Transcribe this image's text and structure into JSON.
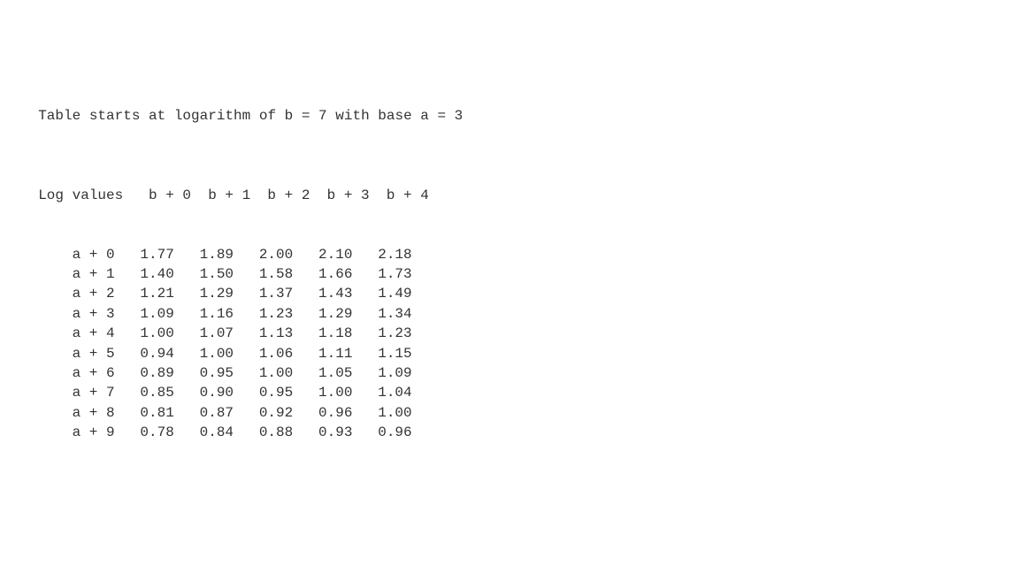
{
  "title": "Table starts at logarithm of b = 7 with base a = 3",
  "header_label": "Log values",
  "columns": [
    "b + 0",
    "b + 1",
    "b + 2",
    "b + 3",
    "b + 4"
  ],
  "rows": [
    {
      "label": "a + 0",
      "values": [
        "1.77",
        "1.89",
        "2.00",
        "2.10",
        "2.18"
      ]
    },
    {
      "label": "a + 1",
      "values": [
        "1.40",
        "1.50",
        "1.58",
        "1.66",
        "1.73"
      ]
    },
    {
      "label": "a + 2",
      "values": [
        "1.21",
        "1.29",
        "1.37",
        "1.43",
        "1.49"
      ]
    },
    {
      "label": "a + 3",
      "values": [
        "1.09",
        "1.16",
        "1.23",
        "1.29",
        "1.34"
      ]
    },
    {
      "label": "a + 4",
      "values": [
        "1.00",
        "1.07",
        "1.13",
        "1.18",
        "1.23"
      ]
    },
    {
      "label": "a + 5",
      "values": [
        "0.94",
        "1.00",
        "1.06",
        "1.11",
        "1.15"
      ]
    },
    {
      "label": "a + 6",
      "values": [
        "0.89",
        "0.95",
        "1.00",
        "1.05",
        "1.09"
      ]
    },
    {
      "label": "a + 7",
      "values": [
        "0.85",
        "0.90",
        "0.95",
        "1.00",
        "1.04"
      ]
    },
    {
      "label": "a + 8",
      "values": [
        "0.81",
        "0.87",
        "0.92",
        "0.96",
        "1.00"
      ]
    },
    {
      "label": "a + 9",
      "values": [
        "0.78",
        "0.84",
        "0.88",
        "0.93",
        "0.96"
      ]
    }
  ]
}
